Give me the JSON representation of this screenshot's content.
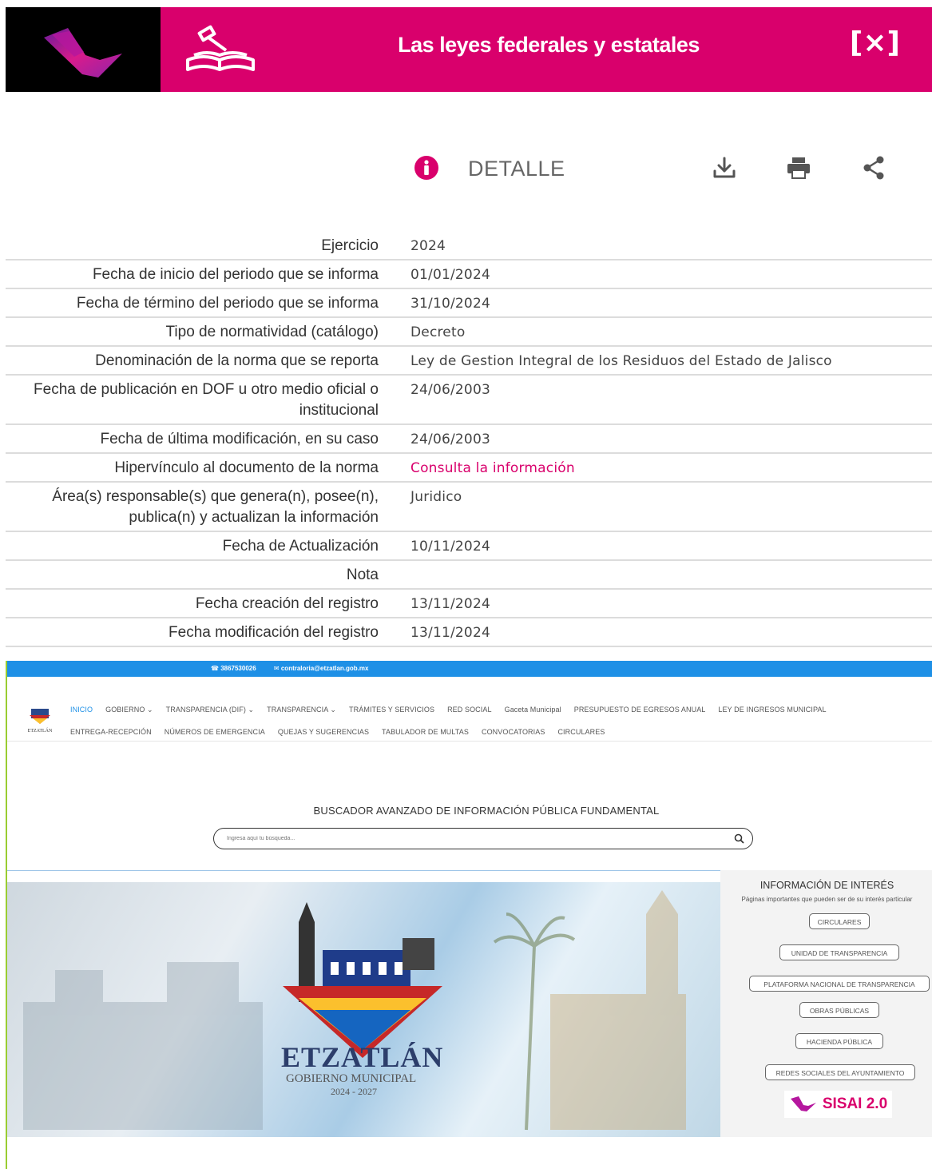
{
  "header": {
    "title": "Las leyes federales y estatales",
    "close_label": "[×]"
  },
  "detail": {
    "title": "DETALLE",
    "tools": [
      "download-icon",
      "print-icon",
      "share-icon"
    ]
  },
  "rows": [
    {
      "label": "Ejercicio",
      "value": "2024"
    },
    {
      "label": "Fecha de inicio del periodo que se informa",
      "value": "01/01/2024"
    },
    {
      "label": "Fecha de término del periodo que se informa",
      "value": "31/10/2024"
    },
    {
      "label": "Tipo de normatividad (catálogo)",
      "value": "Decreto"
    },
    {
      "label": "Denominación de la norma que se reporta",
      "value": "Ley de Gestion Integral de los Residuos del Estado de Jalisco"
    },
    {
      "label": "Fecha de publicación en DOF u otro medio oficial o institucional",
      "value": "24/06/2003"
    },
    {
      "label": "Fecha de última modificación, en su caso",
      "value": "24/06/2003"
    },
    {
      "label": "Hipervínculo al documento de la norma",
      "value": "Consulta la información"
    },
    {
      "label": "Área(s) responsable(s) que genera(n), posee(n), publica(n) y actualizan la información",
      "value": "Juridico"
    },
    {
      "label": "Fecha de Actualización",
      "value": "10/11/2024"
    },
    {
      "label": "Nota",
      "value": ""
    },
    {
      "label": "Fecha creación del registro",
      "value": "13/11/2024"
    },
    {
      "label": "Fecha modificación del registro",
      "value": "13/11/2024"
    }
  ],
  "site": {
    "phone": "3867530026",
    "email": "contraloria@etzatlan.gob.mx",
    "logo_text": "ETZATLÁN",
    "nav": [
      "INICIO",
      "GOBIERNO ⌄",
      "TRANSPARENCIA (DIF) ⌄",
      "TRANSPARENCIA ⌄",
      "TRÁMITES Y SERVICIOS",
      "RED SOCIAL",
      "Gaceta Municipal",
      "PRESUPUESTO DE EGRESOS ANUAL",
      "LEY DE INGRESOS MUNICIPAL",
      "ENTREGA-RECEPCIÓN",
      "NÚMEROS DE EMERGENCIA",
      "QUEJAS Y SUGERENCIAS",
      "TABULADOR DE MULTAS",
      "CONVOCATORIAS",
      "CIRCULARES"
    ],
    "search_title": "BUSCADOR AVANZADO DE INFORMACIÓN PÚBLICA FUNDAMENTAL",
    "search_placeholder": "Ingresa aquí tu búsqueda...",
    "hero": {
      "name": "ETZATLÁN",
      "subtitle": "GOBIERNO MUNICIPAL",
      "years": "2024 - 2027"
    },
    "interest": {
      "title": "INFORMACIÓN DE INTERÉS",
      "subtitle": "Páginas importantes que pueden ser de su interés particular",
      "buttons": [
        "CIRCULARES",
        "UNIDAD DE TRANSPARENCIA",
        "PLATAFORMA NACIONAL DE TRANSPARENCIA",
        "OBRAS PÚBLICAS",
        "HACIENDA PÚBLICA",
        "REDES SOCIALES DEL AYUNTAMIENTO"
      ],
      "sisai_label": "SISAI 2.0"
    }
  },
  "colors": {
    "brand": "#d9006c",
    "site_blue": "#1e90e6"
  }
}
